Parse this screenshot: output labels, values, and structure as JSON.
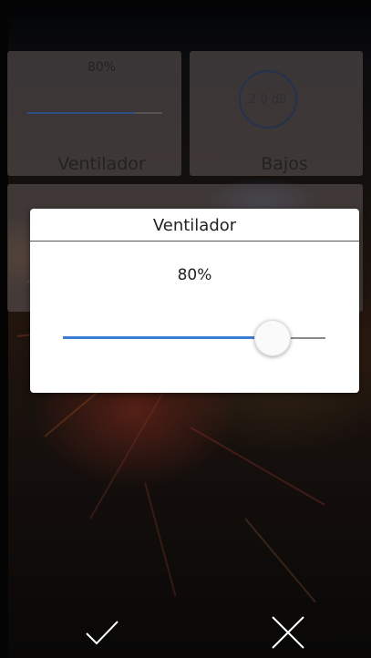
{
  "background_tiles": {
    "fan": {
      "value": "80%",
      "label": "Ventilador",
      "level_percent": 80
    },
    "bass": {
      "value": "2.0 dB",
      "label": "Bajos"
    }
  },
  "dialog": {
    "title": "Ventilador",
    "value_text": "80%",
    "slider_percent": 80
  },
  "bottom_bar": {
    "confirm_icon": "checkmark-icon",
    "cancel_icon": "close-icon"
  },
  "colors": {
    "accent": "#3a7fd5",
    "dialog_bg": "#ffffff",
    "tile_bg": "#786e6e"
  }
}
